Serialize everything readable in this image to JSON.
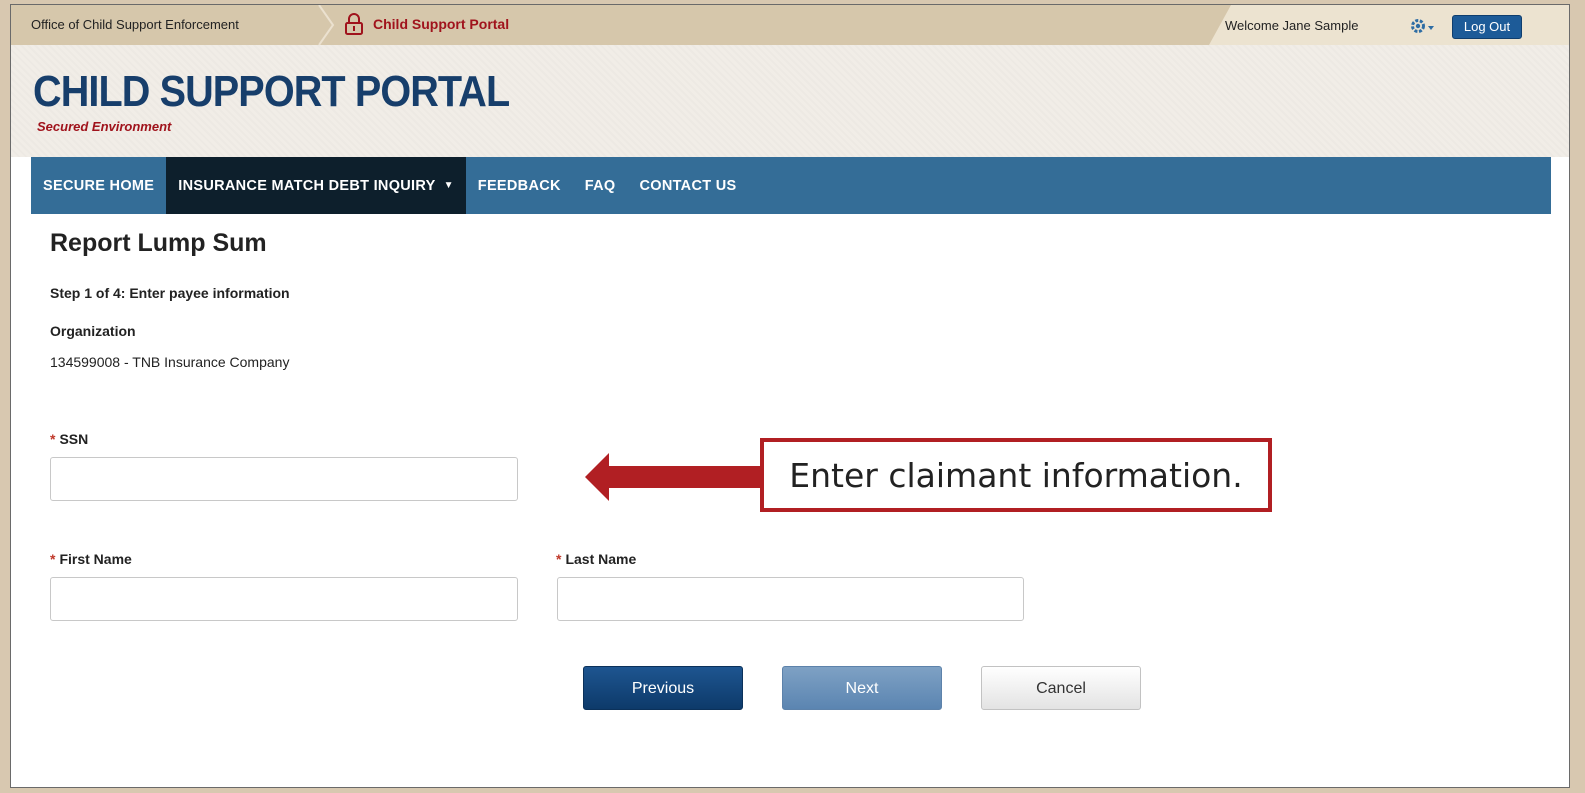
{
  "topbar": {
    "org_name": "Office of Child Support Enforcement",
    "portal_name": "Child Support Portal",
    "welcome": "Welcome Jane Sample",
    "logout_label": "Log Out",
    "lock_icon": "lock-icon",
    "gear_icon": "gear-icon"
  },
  "header": {
    "title": "CHILD SUPPORT PORTAL",
    "subtitle": "Secured Environment"
  },
  "nav": {
    "items": [
      {
        "label": "SECURE HOME"
      },
      {
        "label": "INSURANCE MATCH DEBT INQUIRY"
      },
      {
        "label": "FEEDBACK"
      },
      {
        "label": "FAQ"
      },
      {
        "label": "CONTACT US"
      }
    ],
    "active_index": 1
  },
  "page": {
    "title": "Report Lump Sum",
    "step": "Step 1 of 4: Enter payee information",
    "org_label": "Organization",
    "org_value": "134599008 - TNB Insurance Company"
  },
  "form": {
    "required_mark": "*",
    "ssn_label": "SSN",
    "ssn_value": "",
    "first_name_label": "First Name",
    "first_name_value": "",
    "last_name_label": "Last Name",
    "last_name_value": ""
  },
  "buttons": {
    "previous": "Previous",
    "next": "Next",
    "cancel": "Cancel"
  },
  "callout": {
    "text": "Enter claimant information."
  },
  "colors": {
    "nav_bg": "#346d97",
    "nav_active": "#0d1f2c",
    "brand": "#173e6b",
    "accent_red": "#b11f23"
  }
}
